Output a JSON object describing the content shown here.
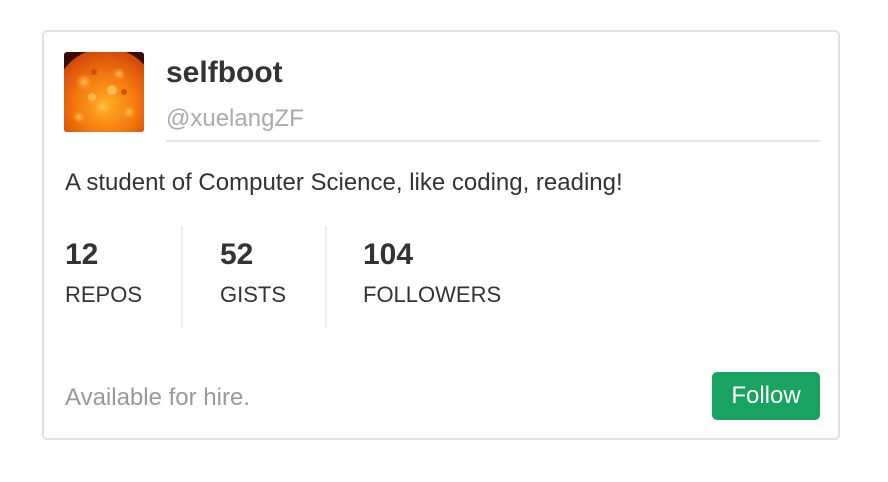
{
  "profile": {
    "name": "selfboot",
    "handle": "@xuelangZF",
    "bio": "A student of Computer Science, like coding, reading!",
    "avatar_icon": "sun-avatar-image"
  },
  "stats": [
    {
      "value": "12",
      "label": "REPOS"
    },
    {
      "value": "52",
      "label": "GISTS"
    },
    {
      "value": "104",
      "label": "FOLLOWERS"
    }
  ],
  "footer": {
    "hire_text": "Available for hire.",
    "follow_label": "Follow"
  },
  "colors": {
    "accent": "#1aa260",
    "muted_text": "#999999",
    "border": "#e1e1e1"
  }
}
